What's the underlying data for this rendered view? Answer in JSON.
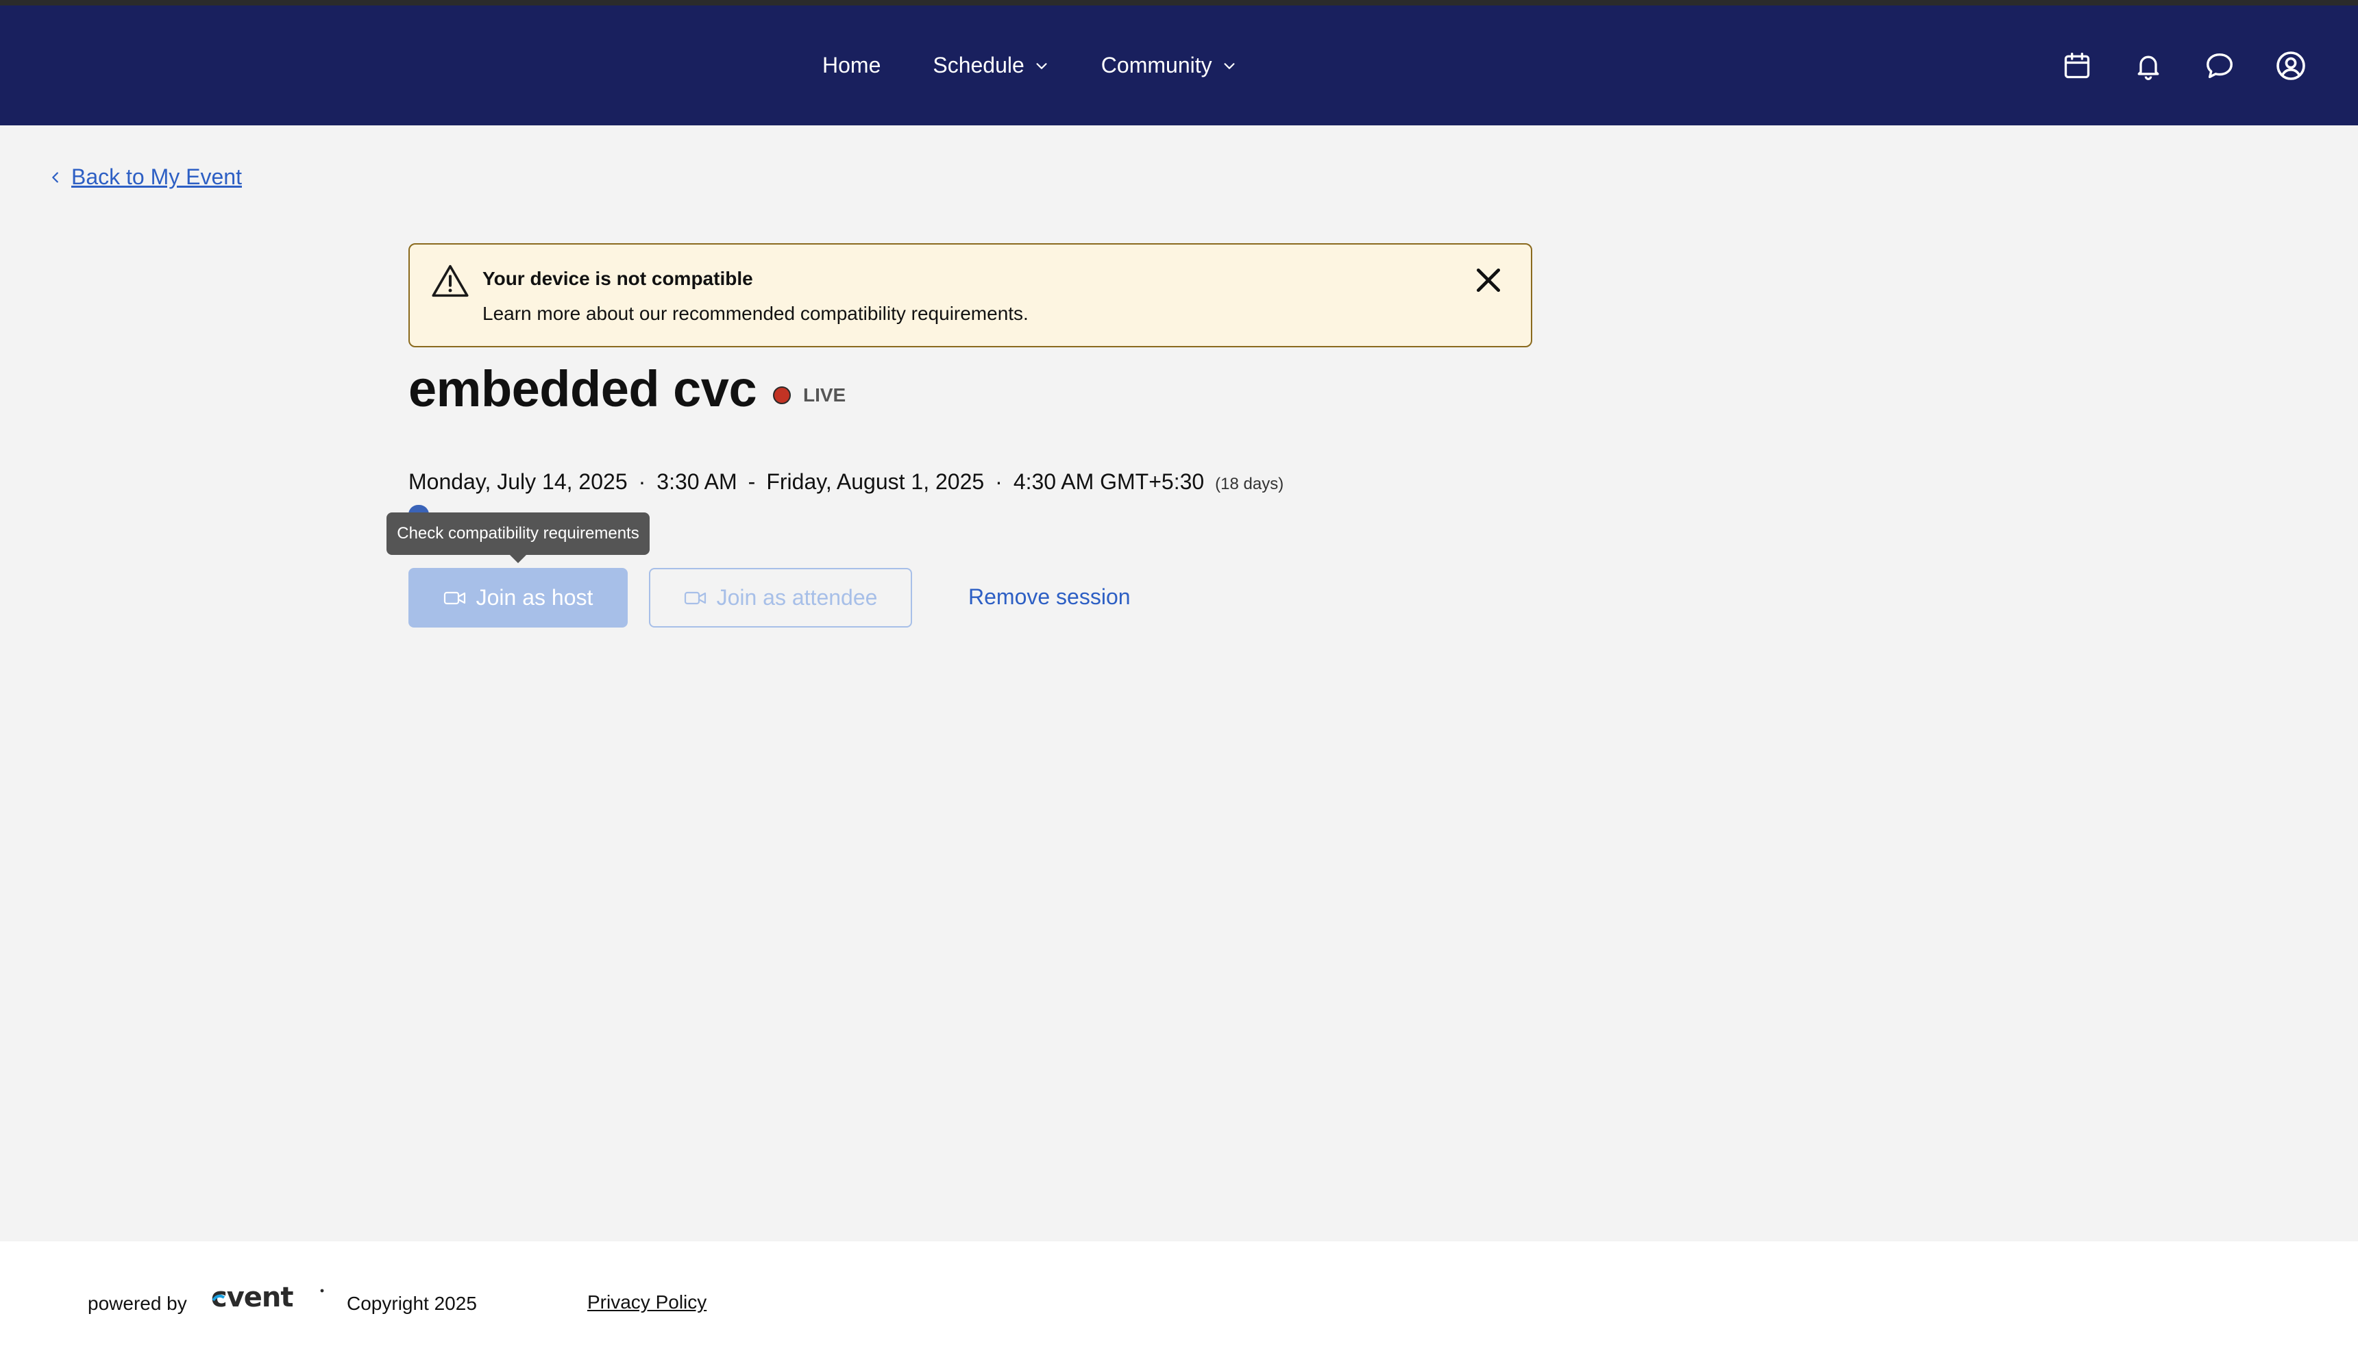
{
  "nav": {
    "items": [
      {
        "label": "Home",
        "icon": null
      },
      {
        "label": "Schedule",
        "icon": "chevron-down-icon"
      },
      {
        "label": "Community",
        "icon": "chevron-down-icon"
      }
    ],
    "right_icons": [
      "calendar-icon",
      "bell-icon",
      "chat-icon",
      "user-avatar-icon"
    ],
    "background": "#19205e"
  },
  "back_link": {
    "label": "Back to My Event",
    "icon": "chevron-left-icon"
  },
  "alert": {
    "title": "Your device is not compatible",
    "description": "Learn more about our recommended compatibility requirements.",
    "icon": "warning-icon",
    "close_icon": "close-icon",
    "background": "#fdf5e1"
  },
  "session": {
    "title": "embedded cvc",
    "status": "LIVE",
    "start_date": "Monday, July 14, 2025",
    "start_time": "3:30 AM",
    "end_date": "Friday, August 1, 2025",
    "end_time": "4:30 AM GMT+5:30",
    "duration": "(18 days)"
  },
  "tooltip": {
    "text": "Check compatibility requirements"
  },
  "actions": {
    "join_host": "Join as host",
    "join_attendee": "Join as attendee",
    "remove": "Remove session"
  },
  "footer": {
    "powered_by": "powered by",
    "brand": "cvent",
    "copyright": "Copyright 2025",
    "privacy": "Privacy Policy"
  },
  "colors": {
    "accent": "#2d5fc4",
    "disabled_button": "#a7bfe8",
    "live_dot": "#c23324"
  }
}
